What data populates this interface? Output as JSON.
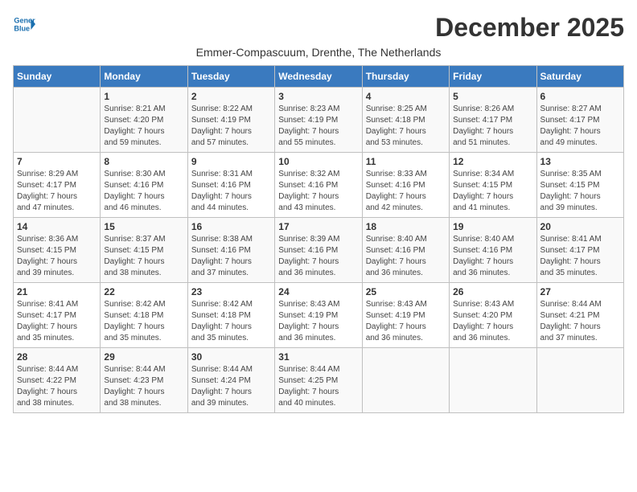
{
  "logo": {
    "line1": "General",
    "line2": "Blue",
    "icon": "▶"
  },
  "title": "December 2025",
  "subtitle": "Emmer-Compascuum, Drenthe, The Netherlands",
  "weekdays": [
    "Sunday",
    "Monday",
    "Tuesday",
    "Wednesday",
    "Thursday",
    "Friday",
    "Saturday"
  ],
  "weeks": [
    [
      {
        "day": "",
        "info": ""
      },
      {
        "day": "1",
        "info": "Sunrise: 8:21 AM\nSunset: 4:20 PM\nDaylight: 7 hours\nand 59 minutes."
      },
      {
        "day": "2",
        "info": "Sunrise: 8:22 AM\nSunset: 4:19 PM\nDaylight: 7 hours\nand 57 minutes."
      },
      {
        "day": "3",
        "info": "Sunrise: 8:23 AM\nSunset: 4:19 PM\nDaylight: 7 hours\nand 55 minutes."
      },
      {
        "day": "4",
        "info": "Sunrise: 8:25 AM\nSunset: 4:18 PM\nDaylight: 7 hours\nand 53 minutes."
      },
      {
        "day": "5",
        "info": "Sunrise: 8:26 AM\nSunset: 4:17 PM\nDaylight: 7 hours\nand 51 minutes."
      },
      {
        "day": "6",
        "info": "Sunrise: 8:27 AM\nSunset: 4:17 PM\nDaylight: 7 hours\nand 49 minutes."
      }
    ],
    [
      {
        "day": "7",
        "info": "Sunrise: 8:29 AM\nSunset: 4:17 PM\nDaylight: 7 hours\nand 47 minutes."
      },
      {
        "day": "8",
        "info": "Sunrise: 8:30 AM\nSunset: 4:16 PM\nDaylight: 7 hours\nand 46 minutes."
      },
      {
        "day": "9",
        "info": "Sunrise: 8:31 AM\nSunset: 4:16 PM\nDaylight: 7 hours\nand 44 minutes."
      },
      {
        "day": "10",
        "info": "Sunrise: 8:32 AM\nSunset: 4:16 PM\nDaylight: 7 hours\nand 43 minutes."
      },
      {
        "day": "11",
        "info": "Sunrise: 8:33 AM\nSunset: 4:16 PM\nDaylight: 7 hours\nand 42 minutes."
      },
      {
        "day": "12",
        "info": "Sunrise: 8:34 AM\nSunset: 4:15 PM\nDaylight: 7 hours\nand 41 minutes."
      },
      {
        "day": "13",
        "info": "Sunrise: 8:35 AM\nSunset: 4:15 PM\nDaylight: 7 hours\nand 39 minutes."
      }
    ],
    [
      {
        "day": "14",
        "info": "Sunrise: 8:36 AM\nSunset: 4:15 PM\nDaylight: 7 hours\nand 39 minutes."
      },
      {
        "day": "15",
        "info": "Sunrise: 8:37 AM\nSunset: 4:15 PM\nDaylight: 7 hours\nand 38 minutes."
      },
      {
        "day": "16",
        "info": "Sunrise: 8:38 AM\nSunset: 4:16 PM\nDaylight: 7 hours\nand 37 minutes."
      },
      {
        "day": "17",
        "info": "Sunrise: 8:39 AM\nSunset: 4:16 PM\nDaylight: 7 hours\nand 36 minutes."
      },
      {
        "day": "18",
        "info": "Sunrise: 8:40 AM\nSunset: 4:16 PM\nDaylight: 7 hours\nand 36 minutes."
      },
      {
        "day": "19",
        "info": "Sunrise: 8:40 AM\nSunset: 4:16 PM\nDaylight: 7 hours\nand 36 minutes."
      },
      {
        "day": "20",
        "info": "Sunrise: 8:41 AM\nSunset: 4:17 PM\nDaylight: 7 hours\nand 35 minutes."
      }
    ],
    [
      {
        "day": "21",
        "info": "Sunrise: 8:41 AM\nSunset: 4:17 PM\nDaylight: 7 hours\nand 35 minutes."
      },
      {
        "day": "22",
        "info": "Sunrise: 8:42 AM\nSunset: 4:18 PM\nDaylight: 7 hours\nand 35 minutes."
      },
      {
        "day": "23",
        "info": "Sunrise: 8:42 AM\nSunset: 4:18 PM\nDaylight: 7 hours\nand 35 minutes."
      },
      {
        "day": "24",
        "info": "Sunrise: 8:43 AM\nSunset: 4:19 PM\nDaylight: 7 hours\nand 36 minutes."
      },
      {
        "day": "25",
        "info": "Sunrise: 8:43 AM\nSunset: 4:19 PM\nDaylight: 7 hours\nand 36 minutes."
      },
      {
        "day": "26",
        "info": "Sunrise: 8:43 AM\nSunset: 4:20 PM\nDaylight: 7 hours\nand 36 minutes."
      },
      {
        "day": "27",
        "info": "Sunrise: 8:44 AM\nSunset: 4:21 PM\nDaylight: 7 hours\nand 37 minutes."
      }
    ],
    [
      {
        "day": "28",
        "info": "Sunrise: 8:44 AM\nSunset: 4:22 PM\nDaylight: 7 hours\nand 38 minutes."
      },
      {
        "day": "29",
        "info": "Sunrise: 8:44 AM\nSunset: 4:23 PM\nDaylight: 7 hours\nand 38 minutes."
      },
      {
        "day": "30",
        "info": "Sunrise: 8:44 AM\nSunset: 4:24 PM\nDaylight: 7 hours\nand 39 minutes."
      },
      {
        "day": "31",
        "info": "Sunrise: 8:44 AM\nSunset: 4:25 PM\nDaylight: 7 hours\nand 40 minutes."
      },
      {
        "day": "",
        "info": ""
      },
      {
        "day": "",
        "info": ""
      },
      {
        "day": "",
        "info": ""
      }
    ]
  ]
}
